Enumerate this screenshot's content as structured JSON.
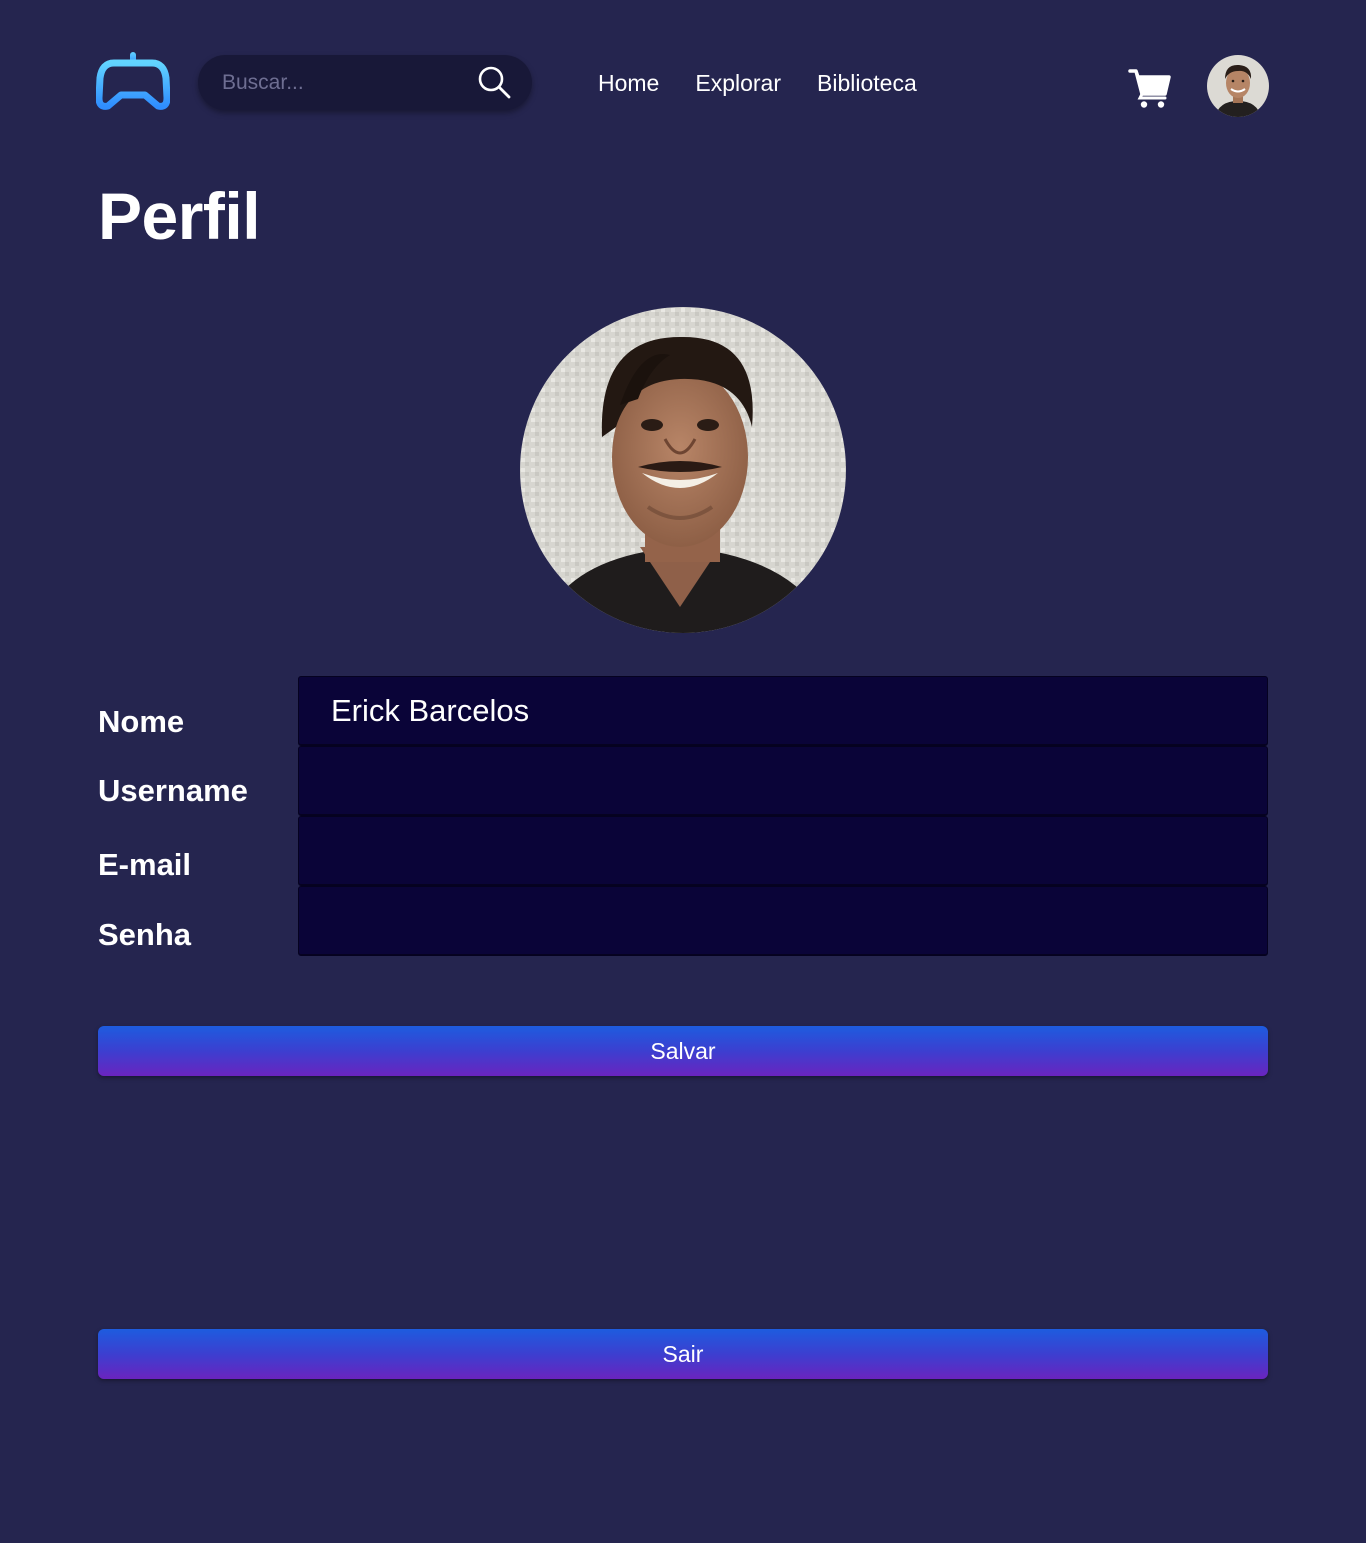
{
  "header": {
    "logo_icon": "gamepad-icon",
    "search": {
      "placeholder": "Buscar...",
      "value": "",
      "icon": "search-icon"
    },
    "nav": [
      {
        "label": "Home"
      },
      {
        "label": "Explorar"
      },
      {
        "label": "Biblioteca"
      }
    ],
    "cart_icon": "cart-icon",
    "avatar": "user-avatar"
  },
  "page": {
    "title": "Perfil",
    "photo": "profile-photo"
  },
  "form": {
    "fields": [
      {
        "label": "Nome",
        "value": "Erick Barcelos"
      },
      {
        "label": "Username",
        "value": ""
      },
      {
        "label": "E-mail",
        "value": ""
      },
      {
        "label": "Senha",
        "value": ""
      }
    ]
  },
  "actions": {
    "save_label": "Salvar",
    "logout_label": "Sair"
  },
  "colors": {
    "background": "#25254f",
    "input_bg": "#0a0438",
    "search_bg": "#181838",
    "logo_gradient_start": "#5fd0ff",
    "logo_gradient_end": "#2f8dff",
    "button_gradient_top": "#1d5cdf",
    "button_gradient_bottom": "#6a24bf"
  }
}
